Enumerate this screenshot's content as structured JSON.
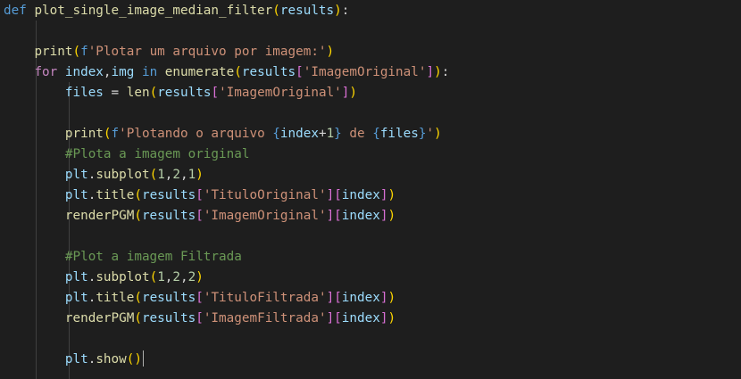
{
  "theme": {
    "background": "#1e1e1e",
    "indent_guide": "#404040",
    "cursor": "#aeafad",
    "tokens": {
      "kw": "#569cd6",
      "ctrl": "#c586c0",
      "fn": "#dcdcaa",
      "var": "#9cdcfe",
      "str": "#ce9178",
      "num": "#b5cea8",
      "cmt": "#6a9955",
      "p": "#d4d4d4",
      "b1": "#ffd700",
      "b2": "#da70d6",
      "b3": "#179fff"
    }
  },
  "editor": {
    "language": "python",
    "active_line": 17,
    "lines": [
      [
        [
          "kw",
          "def"
        ],
        [
          "p",
          " "
        ],
        [
          "fn",
          "plot_single_image_median_filter"
        ],
        [
          "b1",
          "("
        ],
        [
          "var",
          "results"
        ],
        [
          "b1",
          ")"
        ],
        [
          "p",
          ":"
        ]
      ],
      [],
      [
        [
          "p",
          "    "
        ],
        [
          "fn",
          "print"
        ],
        [
          "b1",
          "("
        ],
        [
          "kw",
          "f"
        ],
        [
          "str",
          "'Plotar um arquivo por imagem:'"
        ],
        [
          "b1",
          ")"
        ]
      ],
      [
        [
          "p",
          "    "
        ],
        [
          "ctrl",
          "for"
        ],
        [
          "p",
          " "
        ],
        [
          "var",
          "index"
        ],
        [
          "p",
          ","
        ],
        [
          "var",
          "img"
        ],
        [
          "p",
          " "
        ],
        [
          "kw",
          "in"
        ],
        [
          "p",
          " "
        ],
        [
          "fn",
          "enumerate"
        ],
        [
          "b1",
          "("
        ],
        [
          "var",
          "results"
        ],
        [
          "b2",
          "["
        ],
        [
          "str",
          "'ImagemOriginal'"
        ],
        [
          "b2",
          "]"
        ],
        [
          "b1",
          ")"
        ],
        [
          "p",
          ":"
        ]
      ],
      [
        [
          "p",
          "        "
        ],
        [
          "var",
          "files"
        ],
        [
          "p",
          " = "
        ],
        [
          "fn",
          "len"
        ],
        [
          "b1",
          "("
        ],
        [
          "var",
          "results"
        ],
        [
          "b2",
          "["
        ],
        [
          "str",
          "'ImagemOriginal'"
        ],
        [
          "b2",
          "]"
        ],
        [
          "b1",
          ")"
        ]
      ],
      [],
      [
        [
          "p",
          "        "
        ],
        [
          "fn",
          "print"
        ],
        [
          "b1",
          "("
        ],
        [
          "kw",
          "f"
        ],
        [
          "str",
          "'Plotando o arquivo "
        ],
        [
          "kw",
          "{"
        ],
        [
          "var",
          "index"
        ],
        [
          "p",
          "+"
        ],
        [
          "num",
          "1"
        ],
        [
          "kw",
          "}"
        ],
        [
          "str",
          " de "
        ],
        [
          "kw",
          "{"
        ],
        [
          "var",
          "files"
        ],
        [
          "kw",
          "}"
        ],
        [
          "str",
          "'"
        ],
        [
          "b1",
          ")"
        ]
      ],
      [
        [
          "p",
          "        "
        ],
        [
          "cmt",
          "#Plota a imagem original"
        ]
      ],
      [
        [
          "p",
          "        "
        ],
        [
          "var",
          "plt"
        ],
        [
          "p",
          "."
        ],
        [
          "fn",
          "subplot"
        ],
        [
          "b1",
          "("
        ],
        [
          "num",
          "1"
        ],
        [
          "p",
          ","
        ],
        [
          "num",
          "2"
        ],
        [
          "p",
          ","
        ],
        [
          "num",
          "1"
        ],
        [
          "b1",
          ")"
        ]
      ],
      [
        [
          "p",
          "        "
        ],
        [
          "var",
          "plt"
        ],
        [
          "p",
          "."
        ],
        [
          "fn",
          "title"
        ],
        [
          "b1",
          "("
        ],
        [
          "var",
          "results"
        ],
        [
          "b2",
          "["
        ],
        [
          "str",
          "'TituloOriginal'"
        ],
        [
          "b2",
          "]"
        ],
        [
          "b2",
          "["
        ],
        [
          "var",
          "index"
        ],
        [
          "b2",
          "]"
        ],
        [
          "b1",
          ")"
        ]
      ],
      [
        [
          "p",
          "        "
        ],
        [
          "fn",
          "renderPGM"
        ],
        [
          "b1",
          "("
        ],
        [
          "var",
          "results"
        ],
        [
          "b2",
          "["
        ],
        [
          "str",
          "'ImagemOriginal'"
        ],
        [
          "b2",
          "]"
        ],
        [
          "b2",
          "["
        ],
        [
          "var",
          "index"
        ],
        [
          "b2",
          "]"
        ],
        [
          "b1",
          ")"
        ]
      ],
      [],
      [
        [
          "p",
          "        "
        ],
        [
          "cmt",
          "#Plot a imagem Filtrada"
        ]
      ],
      [
        [
          "p",
          "        "
        ],
        [
          "var",
          "plt"
        ],
        [
          "p",
          "."
        ],
        [
          "fn",
          "subplot"
        ],
        [
          "b1",
          "("
        ],
        [
          "num",
          "1"
        ],
        [
          "p",
          ","
        ],
        [
          "num",
          "2"
        ],
        [
          "p",
          ","
        ],
        [
          "num",
          "2"
        ],
        [
          "b1",
          ")"
        ]
      ],
      [
        [
          "p",
          "        "
        ],
        [
          "var",
          "plt"
        ],
        [
          "p",
          "."
        ],
        [
          "fn",
          "title"
        ],
        [
          "b1",
          "("
        ],
        [
          "var",
          "results"
        ],
        [
          "b2",
          "["
        ],
        [
          "str",
          "'TituloFiltrada'"
        ],
        [
          "b2",
          "]"
        ],
        [
          "b2",
          "["
        ],
        [
          "var",
          "index"
        ],
        [
          "b2",
          "]"
        ],
        [
          "b1",
          ")"
        ]
      ],
      [
        [
          "p",
          "        "
        ],
        [
          "fn",
          "renderPGM"
        ],
        [
          "b1",
          "("
        ],
        [
          "var",
          "results"
        ],
        [
          "b2",
          "["
        ],
        [
          "str",
          "'ImagemFiltrada'"
        ],
        [
          "b2",
          "]"
        ],
        [
          "b2",
          "["
        ],
        [
          "var",
          "index"
        ],
        [
          "b2",
          "]"
        ],
        [
          "b1",
          ")"
        ]
      ],
      [],
      [
        [
          "p",
          "        "
        ],
        [
          "var",
          "plt"
        ],
        [
          "p",
          "."
        ],
        [
          "fn",
          "show"
        ],
        [
          "b1",
          "("
        ],
        [
          "b1",
          ")"
        ]
      ]
    ]
  }
}
